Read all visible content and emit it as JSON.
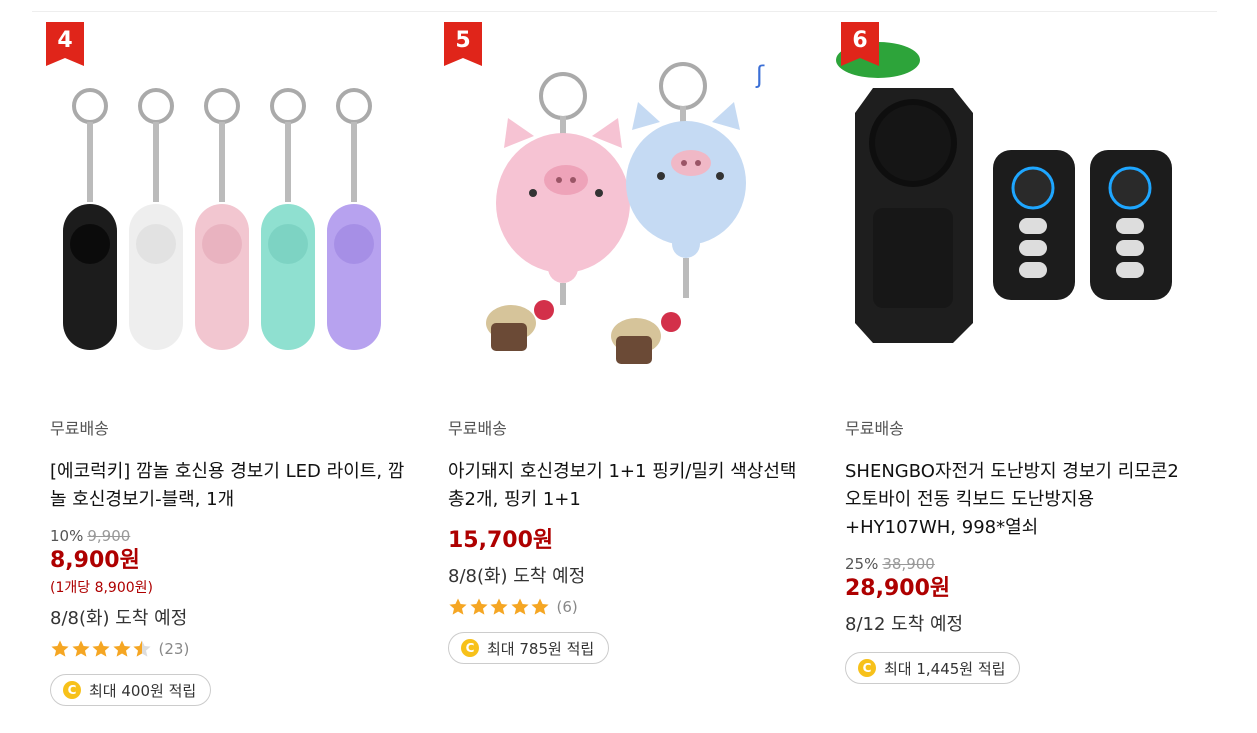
{
  "colors": {
    "price": "#ae0000",
    "rank_badge": "#e0251a",
    "star": "#f5a623",
    "coin": "#f7c11a"
  },
  "products": [
    {
      "rank": "4",
      "shipping": "무료배송",
      "title": "[에코럭키] 깜놀 호신용 경보기 LED 라이트, 깜놀 호신경보기-블랙, 1개",
      "discount_rate": "10%",
      "original_price": "9,900",
      "price": "8,900원",
      "unit_price": "(1개당 8,900원)",
      "arrival": "8/8(화) 도착 예정",
      "rating": 4.5,
      "review_count": "(23)",
      "coin_icon": "C",
      "reward": "최대 400원 적립"
    },
    {
      "rank": "5",
      "shipping": "무료배송",
      "title": "아기돼지 호신경보기 1+1 핑키/밀키 색상선택 총2개, 핑키 1+1",
      "price": "15,700원",
      "arrival": "8/8(화) 도착 예정",
      "rating": 5,
      "review_count": "(6)",
      "coin_icon": "C",
      "reward": "최대 785원 적립"
    },
    {
      "rank": "6",
      "shipping": "무료배송",
      "title": "SHENGBO자전거 도난방지 경보기 리모콘2 오토바이 전동 킥보드 도난방지용+HY107WH, 998*열쇠",
      "discount_rate": "25%",
      "original_price": "38,900",
      "price": "28,900원",
      "arrival": "8/12 도착 예정",
      "coin_icon": "C",
      "reward": "최대 1,445원 적립"
    }
  ]
}
